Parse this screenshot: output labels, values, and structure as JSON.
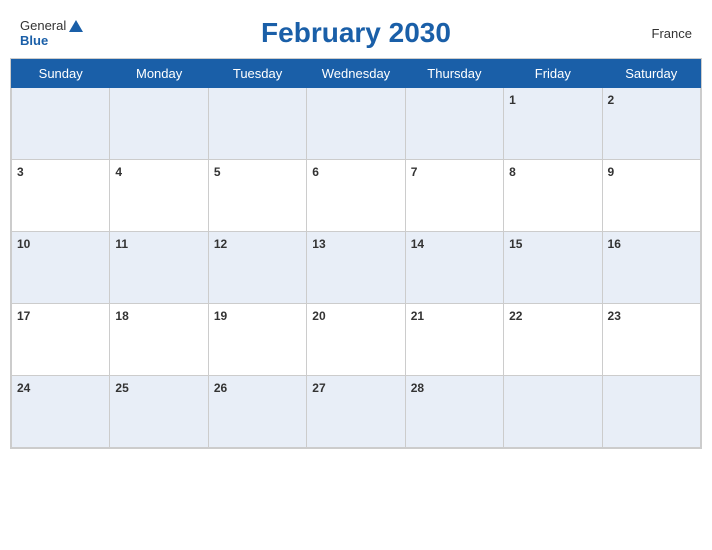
{
  "header": {
    "logo_general": "General",
    "logo_blue": "Blue",
    "title": "February 2030",
    "country": "France"
  },
  "calendar": {
    "days_of_week": [
      "Sunday",
      "Monday",
      "Tuesday",
      "Wednesday",
      "Thursday",
      "Friday",
      "Saturday"
    ],
    "weeks": [
      [
        null,
        null,
        null,
        null,
        null,
        1,
        2
      ],
      [
        3,
        4,
        5,
        6,
        7,
        8,
        9
      ],
      [
        10,
        11,
        12,
        13,
        14,
        15,
        16
      ],
      [
        17,
        18,
        19,
        20,
        21,
        22,
        23
      ],
      [
        24,
        25,
        26,
        27,
        28,
        null,
        null
      ]
    ]
  }
}
